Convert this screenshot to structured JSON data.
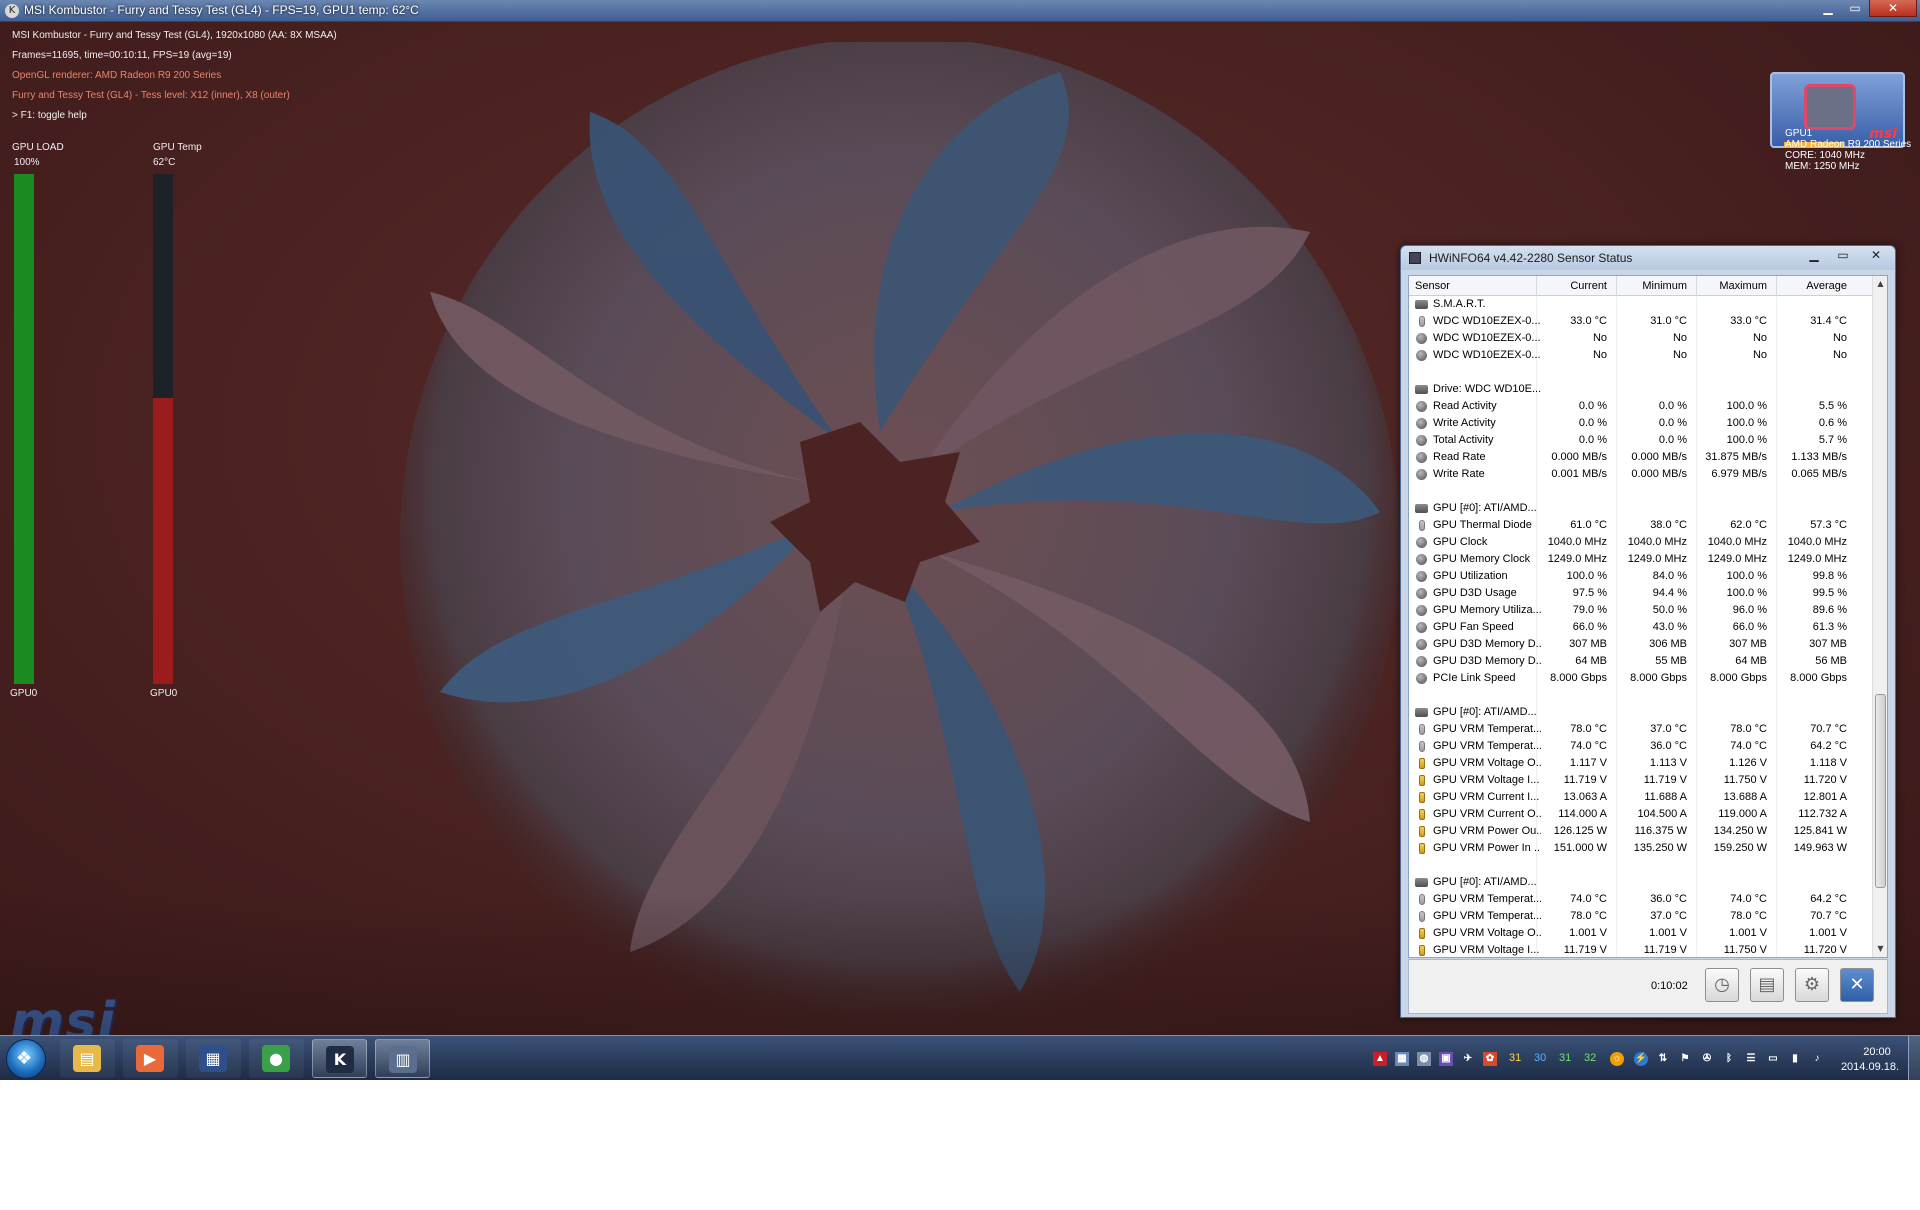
{
  "kombustor": {
    "title": "MSI Kombustor - Furry and Tessy Test (GL4) - FPS=19, GPU1 temp: 62°C",
    "osd": [
      "MSI Kombustor - Furry and Tessy Test (GL4), 1920x1080 (AA: 8X MSAA)",
      "Frames=11695, time=00:10:11, FPS=19 (avg=19)",
      "OpenGL renderer: AMD Radeon R9 200 Series",
      "Furry and Tessy Test (GL4) - Tess level: X12 (inner), X8 (outer)",
      "> F1: toggle help"
    ],
    "gpu_load": {
      "label": "GPU LOAD",
      "value": "100%",
      "level": 1.0,
      "gpu": "GPU0",
      "color": "#1b8a1f"
    },
    "gpu_temp": {
      "label": "GPU Temp",
      "value": "62°C",
      "level": 0.56,
      "gpu": "GPU0",
      "color": "#9a1c1c"
    },
    "gpu_card": {
      "name": "GPU1",
      "model": "AMD Radeon R9 200 Series",
      "core": "CORE: 1040 MHz",
      "mem": "MEM: 1250 MHz",
      "brand": "msi"
    },
    "logo": "msi"
  },
  "hwinfo": {
    "title": "HWiNFO64 v4.42-2280 Sensor Status",
    "columns": [
      "Sensor",
      "Current",
      "Minimum",
      "Maximum",
      "Average"
    ],
    "rows": [
      {
        "type": "group",
        "name": "S.M.A.R.T."
      },
      {
        "icon": "therm",
        "name": "WDC WD10EZEX-0...",
        "cur": "33.0 °C",
        "min": "31.0 °C",
        "max": "33.0 °C",
        "avg": "31.4 °C"
      },
      {
        "icon": "dot",
        "name": "WDC WD10EZEX-0...",
        "cur": "No",
        "min": "No",
        "max": "No",
        "avg": "No"
      },
      {
        "icon": "dot",
        "name": "WDC WD10EZEX-0...",
        "cur": "No",
        "min": "No",
        "max": "No",
        "avg": "No"
      },
      {
        "type": "blank"
      },
      {
        "type": "group",
        "name": "Drive: WDC WD10E..."
      },
      {
        "icon": "dot",
        "name": "Read Activity",
        "cur": "0.0 %",
        "min": "0.0 %",
        "max": "100.0 %",
        "avg": "5.5 %"
      },
      {
        "icon": "dot",
        "name": "Write Activity",
        "cur": "0.0 %",
        "min": "0.0 %",
        "max": "100.0 %",
        "avg": "0.6 %"
      },
      {
        "icon": "dot",
        "name": "Total Activity",
        "cur": "0.0 %",
        "min": "0.0 %",
        "max": "100.0 %",
        "avg": "5.7 %"
      },
      {
        "icon": "dot",
        "name": "Read Rate",
        "cur": "0.000 MB/s",
        "min": "0.000 MB/s",
        "max": "31.875 MB/s",
        "avg": "1.133 MB/s"
      },
      {
        "icon": "dot",
        "name": "Write Rate",
        "cur": "0.001 MB/s",
        "min": "0.000 MB/s",
        "max": "6.979 MB/s",
        "avg": "0.065 MB/s"
      },
      {
        "type": "blank"
      },
      {
        "type": "group",
        "name": "GPU [#0]: ATI/AMD..."
      },
      {
        "icon": "therm",
        "name": "GPU Thermal Diode",
        "cur": "61.0 °C",
        "min": "38.0 °C",
        "max": "62.0 °C",
        "avg": "57.3 °C"
      },
      {
        "icon": "dot",
        "name": "GPU Clock",
        "cur": "1040.0 MHz",
        "min": "1040.0 MHz",
        "max": "1040.0 MHz",
        "avg": "1040.0 MHz"
      },
      {
        "icon": "dot",
        "name": "GPU Memory Clock",
        "cur": "1249.0 MHz",
        "min": "1249.0 MHz",
        "max": "1249.0 MHz",
        "avg": "1249.0 MHz"
      },
      {
        "icon": "dot",
        "name": "GPU Utilization",
        "cur": "100.0 %",
        "min": "84.0 %",
        "max": "100.0 %",
        "avg": "99.8 %"
      },
      {
        "icon": "dot",
        "name": "GPU D3D Usage",
        "cur": "97.5 %",
        "min": "94.4 %",
        "max": "100.0 %",
        "avg": "99.5 %"
      },
      {
        "icon": "dot",
        "name": "GPU Memory Utiliza...",
        "cur": "79.0 %",
        "min": "50.0 %",
        "max": "96.0 %",
        "avg": "89.6 %"
      },
      {
        "icon": "dot",
        "name": "GPU Fan Speed",
        "cur": "66.0 %",
        "min": "43.0 %",
        "max": "66.0 %",
        "avg": "61.3 %"
      },
      {
        "icon": "dot",
        "name": "GPU D3D Memory D...",
        "cur": "307 MB",
        "min": "306 MB",
        "max": "307 MB",
        "avg": "307 MB"
      },
      {
        "icon": "dot",
        "name": "GPU D3D Memory D...",
        "cur": "64 MB",
        "min": "55 MB",
        "max": "64 MB",
        "avg": "56 MB"
      },
      {
        "icon": "dot",
        "name": "PCIe Link Speed",
        "cur": "8.000 Gbps",
        "min": "8.000 Gbps",
        "max": "8.000 Gbps",
        "avg": "8.000 Gbps"
      },
      {
        "type": "blank"
      },
      {
        "type": "group",
        "name": "GPU [#0]: ATI/AMD..."
      },
      {
        "icon": "therm",
        "name": "GPU VRM Temperat...",
        "cur": "78.0 °C",
        "min": "37.0 °C",
        "max": "78.0 °C",
        "avg": "70.7 °C"
      },
      {
        "icon": "therm",
        "name": "GPU VRM Temperat...",
        "cur": "74.0 °C",
        "min": "36.0 °C",
        "max": "74.0 °C",
        "avg": "64.2 °C"
      },
      {
        "icon": "volt",
        "name": "GPU VRM Voltage O...",
        "cur": "1.117 V",
        "min": "1.113 V",
        "max": "1.126 V",
        "avg": "1.118 V"
      },
      {
        "icon": "volt",
        "name": "GPU VRM Voltage I...",
        "cur": "11.719 V",
        "min": "11.719 V",
        "max": "11.750 V",
        "avg": "11.720 V"
      },
      {
        "icon": "volt",
        "name": "GPU VRM Current I...",
        "cur": "13.063 A",
        "min": "11.688 A",
        "max": "13.688 A",
        "avg": "12.801 A"
      },
      {
        "icon": "volt",
        "name": "GPU VRM Current O...",
        "cur": "114.000 A",
        "min": "104.500 A",
        "max": "119.000 A",
        "avg": "112.732 A"
      },
      {
        "icon": "volt",
        "name": "GPU VRM Power Ou...",
        "cur": "126.125 W",
        "min": "116.375 W",
        "max": "134.250 W",
        "avg": "125.841 W"
      },
      {
        "icon": "volt",
        "name": "GPU VRM Power In ...",
        "cur": "151.000 W",
        "min": "135.250 W",
        "max": "159.250 W",
        "avg": "149.963 W"
      },
      {
        "type": "blank"
      },
      {
        "type": "group",
        "name": "GPU [#0]: ATI/AMD..."
      },
      {
        "icon": "therm",
        "name": "GPU VRM Temperat...",
        "cur": "74.0 °C",
        "min": "36.0 °C",
        "max": "74.0 °C",
        "avg": "64.2 °C"
      },
      {
        "icon": "therm",
        "name": "GPU VRM Temperat...",
        "cur": "78.0 °C",
        "min": "37.0 °C",
        "max": "78.0 °C",
        "avg": "70.7 °C"
      },
      {
        "icon": "volt",
        "name": "GPU VRM Voltage O...",
        "cur": "1.001 V",
        "min": "1.001 V",
        "max": "1.001 V",
        "avg": "1.001 V"
      },
      {
        "icon": "volt",
        "name": "GPU VRM Voltage I...",
        "cur": "11.719 V",
        "min": "11.719 V",
        "max": "11.750 V",
        "avg": "11.720 V"
      }
    ],
    "elapsed": "0:10:02"
  },
  "taskbar": {
    "apps": [
      {
        "name": "explorer",
        "glyph": "▤",
        "color": "#e7b94a"
      },
      {
        "name": "media-player",
        "glyph": "▶",
        "color": "#e86a3b"
      },
      {
        "name": "save-app",
        "glyph": "▦",
        "color": "#2e4f8a"
      },
      {
        "name": "chrome",
        "glyph": "●",
        "color": "#3aa04a"
      },
      {
        "name": "kombustor",
        "glyph": "K",
        "color": "#1f2c44"
      },
      {
        "name": "hwinfo",
        "glyph": "▥",
        "color": "#5a6e8e"
      }
    ],
    "tray_numbers": [
      {
        "text": "31",
        "color": "#ffd84a"
      },
      {
        "text": "30",
        "color": "#4ab6ff"
      },
      {
        "text": "31",
        "color": "#6ee07a"
      },
      {
        "text": "32",
        "color": "#6ee07a"
      }
    ],
    "clock_time": "20:00",
    "clock_date": "2014.09.18."
  }
}
